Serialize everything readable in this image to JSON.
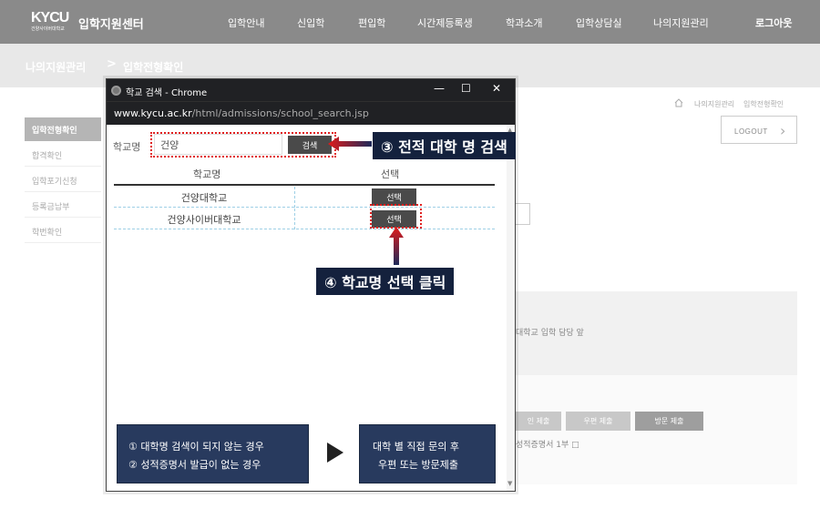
{
  "header": {
    "logo_text": "KYCU",
    "logo_sub": "건양사이버대학교",
    "site_title": "입학지원센터",
    "nav": [
      "입학안내",
      "신입학",
      "편입학",
      "시간제등록생",
      "학과소개",
      "입학상담실",
      "나의지원관리"
    ],
    "login": "로그아웃"
  },
  "breadcrumb": {
    "level1": "나의지원관리",
    "separator": ">",
    "level2": "입학전형확인"
  },
  "sidebar": {
    "items": [
      {
        "label": "입학전형확인",
        "active": true
      },
      {
        "label": "합격확인",
        "active": false
      },
      {
        "label": "입학포기신청",
        "active": false
      },
      {
        "label": "등록금납부",
        "active": false
      },
      {
        "label": "학번확인",
        "active": false
      }
    ]
  },
  "page": {
    "mini_crumb_1": "나의지원관리",
    "mini_crumb_2": "입학전형확인",
    "logout_button": "LOGOUT",
    "bg_text_1": "대학교 입학 담당 앞",
    "bg_text_2": "성적증명서 1부 □",
    "bg_btn_1": "인 제출",
    "bg_btn_2": "우편 제출",
    "bg_btn_3": "방문 제출"
  },
  "popup": {
    "window_title": "학교 검색 - Chrome",
    "url_host": "www.kycu.ac.kr",
    "url_path": "/html/admissions/school_search.jsp",
    "search_label": "학교명",
    "search_value": "건양",
    "search_button": "검색",
    "table": {
      "headers": [
        "학교명",
        "선택"
      ],
      "rows": [
        {
          "name": "건양대학교",
          "action": "선택"
        },
        {
          "name": "건양사이버대학교",
          "action": "선택"
        }
      ]
    },
    "info_left_line1": "① 대학명 검색이 되지 않는 경우",
    "info_left_line2": "② 성적증명서 발급이 없는 경우",
    "info_right_line1": "대학 별 직접 문의 후",
    "info_right_line2": "우편 또는 방문제출"
  },
  "callouts": {
    "step3": "③ 전적 대학 명 검색",
    "step4": "④ 학교명 선택 클릭"
  },
  "colors": {
    "nav_bg": "#8a8a8a",
    "callout_bg": "#14213d",
    "highlight": "#e02020",
    "info_box": "#283a5e"
  }
}
